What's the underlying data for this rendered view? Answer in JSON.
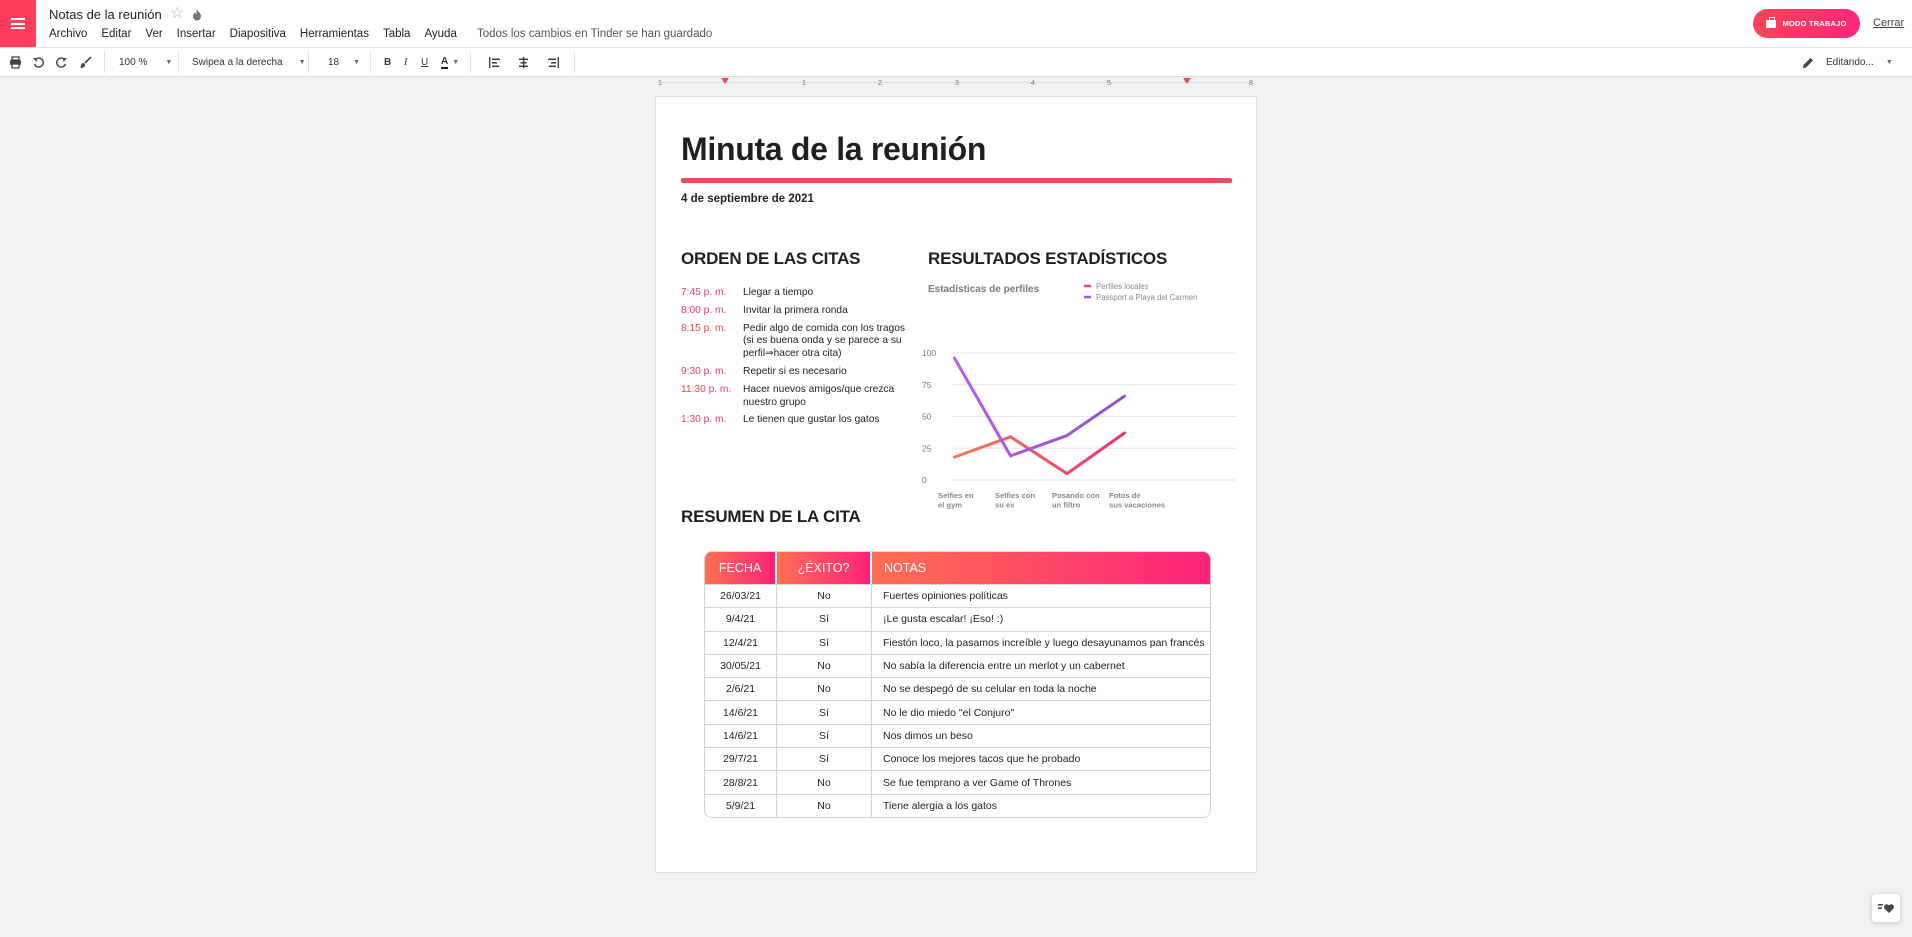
{
  "app": {
    "doc_title": "Notas de la reunión",
    "save_status": "Todos los cambios en Tinder se han guardado",
    "work_mode_label": "MODO TRABAJO",
    "close_label": "Cerrar",
    "brand_color": "#fe3c5b"
  },
  "menubar": [
    "Archivo",
    "Editar",
    "Ver",
    "Insertar",
    "Diapositiva",
    "Herramientas",
    "Tabla",
    "Ayuda"
  ],
  "toolbar": {
    "zoom": "100 %",
    "transition": "Swipea a la derecha",
    "font_size": "18",
    "bold": "B",
    "italic": "I",
    "underline": "U",
    "text_color": "A",
    "mode": "Editando..."
  },
  "ruler": [
    "1",
    "1",
    "2",
    "3",
    "4",
    "5",
    "8"
  ],
  "document": {
    "heading": "Minuta de la reunión",
    "date": "4 de septiembre de 2021",
    "schedule_title": "ORDEN DE LAS CITAS",
    "stats_title": "RESULTADOS ESTADÍSTICOS",
    "summary_title": "RESUMEN DE LA CITA",
    "schedule": [
      {
        "time": "7:45  p. m.",
        "activity": "Llegar a tiempo"
      },
      {
        "time": "8:00  p. m.",
        "activity": "Invitar la primera ronda"
      },
      {
        "time": "8:15  p. m.",
        "activity": "Pedir algo de comida con los tragos (si es buena onda y se parece a su perfil⇒hacer otra cita)"
      },
      {
        "time": "9:30  p. m.",
        "activity": "Repetir si es necesario"
      },
      {
        "time": "11:30 p. m.",
        "activity": "Hacer nuevos amigos/que crezca nuestro grupo"
      },
      {
        "time": "1:30  p. m.",
        "activity": "Le tienen que gustar los gatos"
      }
    ],
    "table": {
      "headers": [
        "FECHA",
        "¿ÉXITO?",
        "NOTAS"
      ],
      "rows": [
        [
          "26/03/21",
          "No",
          "Fuertes opiniones políticas"
        ],
        [
          "9/4/21",
          "Sí",
          "¡Le gusta escalar! ¡Eso! :)"
        ],
        [
          "12/4/21",
          "Sí",
          "Fiestón loco, la pasamos increíble y luego desayunamos pan francés"
        ],
        [
          "30/05/21",
          "No",
          "No sabía la diferencia entre un merlot y un cabernet"
        ],
        [
          "2/6/21",
          "No",
          "No se despegó de su celular en toda la noche"
        ],
        [
          "14/6/21",
          "Sí",
          "No le dio miedo \"el Conjuro\""
        ],
        [
          "14/6/21",
          "Sí",
          "Nos dimos un beso"
        ],
        [
          "29/7/21",
          "Sí",
          "Conoce los mejores tacos que he probado"
        ],
        [
          "28/8/21",
          "No",
          "Se fue temprano a ver Game of Thrones"
        ],
        [
          "5/9/21",
          "No",
          "Tiene alergia a los gatos"
        ]
      ]
    }
  },
  "chart_data": {
    "type": "line",
    "title": "Estadísticas de perfiles",
    "categories": [
      "Selfies en el gym",
      "Selfies con su ex",
      "Posando con un filtro",
      "Fotos de sus vacaciones"
    ],
    "yticks": [
      0,
      25,
      50,
      75,
      100
    ],
    "ylim": [
      0,
      100
    ],
    "grid": true,
    "legend_position": "top-right",
    "series": [
      {
        "name": "Perfiles locales",
        "values": [
          18,
          34,
          5,
          37
        ],
        "color": "#f0426a"
      },
      {
        "name": "Passport a Playa del Carmen",
        "values": [
          96,
          19,
          35,
          66
        ],
        "color": "#a35ad8"
      }
    ]
  }
}
